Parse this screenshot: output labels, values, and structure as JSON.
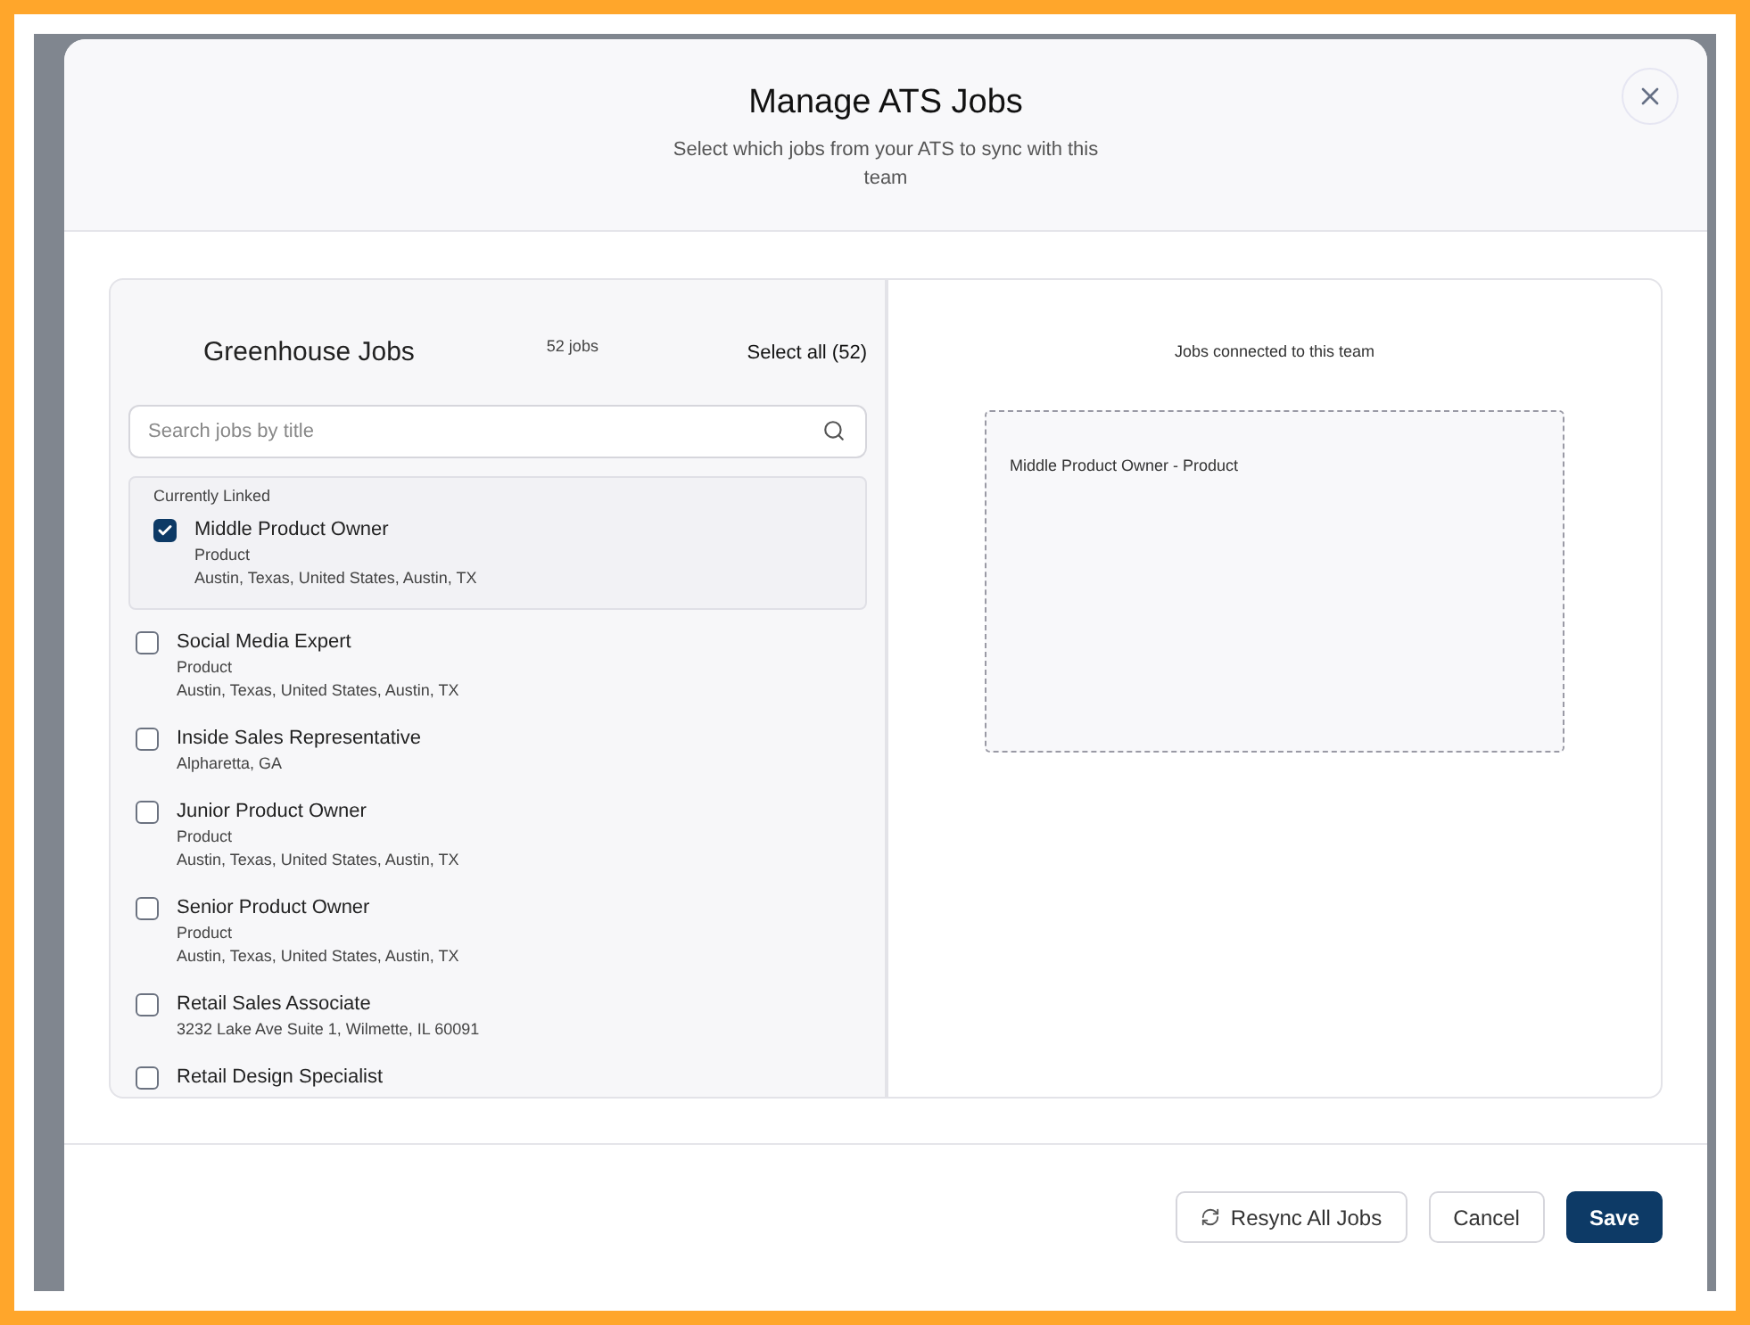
{
  "dialog": {
    "title": "Manage ATS Jobs",
    "subtitle": "Select which jobs from your ATS to sync with this team"
  },
  "source": {
    "title": "Greenhouse Jobs",
    "count": "52 jobs",
    "select_all": "Select all (52)",
    "search": {
      "placeholder": "Search jobs by title"
    },
    "linked_heading": "Currently Linked",
    "linked": [
      {
        "title": "Middle Product Owner",
        "details": [
          "Product",
          "Austin, Texas, United States, Austin, TX"
        ],
        "checked": true
      }
    ],
    "jobs": [
      {
        "title": "Social Media Expert",
        "details": [
          "Product",
          "Austin, Texas, United States, Austin, TX"
        ],
        "checked": false
      },
      {
        "title": "Inside Sales Representative",
        "details": [
          "Alpharetta, GA"
        ],
        "checked": false
      },
      {
        "title": "Junior Product Owner",
        "details": [
          "Product",
          "Austin, Texas, United States, Austin, TX"
        ],
        "checked": false
      },
      {
        "title": "Senior Product Owner",
        "details": [
          "Product",
          "Austin, Texas, United States, Austin, TX"
        ],
        "checked": false
      },
      {
        "title": "Retail Sales Associate",
        "details": [
          "3232 Lake Ave Suite 1, Wilmette, IL 60091"
        ],
        "checked": false
      },
      {
        "title": "Retail Design Specialist",
        "checked": false
      }
    ]
  },
  "connected": {
    "heading": "Jobs connected to this team",
    "items": [
      "Middle Product Owner - Product"
    ]
  },
  "footer": {
    "buttons": [
      {
        "label": "Resync All Jobs",
        "kind": "resync"
      },
      {
        "label": "Cancel",
        "kind": "secondary"
      },
      {
        "label": "Save",
        "kind": "primary"
      }
    ]
  }
}
